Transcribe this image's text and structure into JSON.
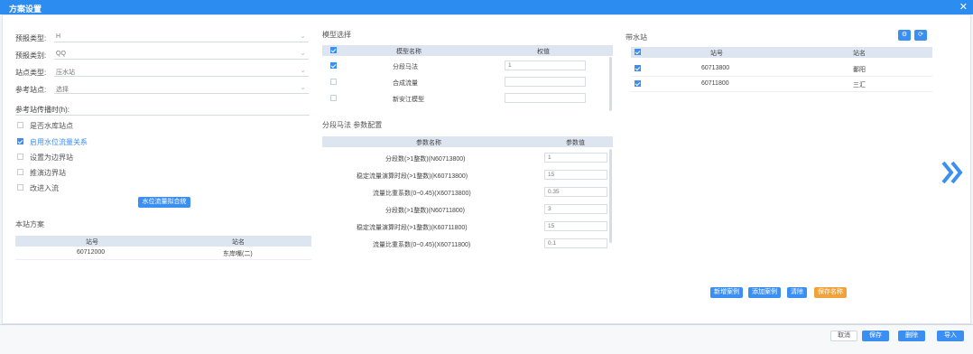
{
  "window": {
    "title": "方案设置",
    "close": "✕"
  },
  "left": {
    "fields": [
      {
        "label": "预报类型:",
        "value": "H"
      },
      {
        "label": "预报类别:",
        "value": "QQ"
      },
      {
        "label": "站点类型:",
        "value": "压水站"
      },
      {
        "label": "参考站点:",
        "value": "选择"
      }
    ],
    "ref_input_label": "参考站传播时(h):",
    "checkboxes": [
      {
        "label": "是否水库站点",
        "checked": false
      },
      {
        "label": "启用水位流量关系",
        "checked": true
      },
      {
        "label": "设置为边界站",
        "checked": false
      },
      {
        "label": "推演边界站",
        "checked": false
      },
      {
        "label": "改进入流",
        "checked": false
      }
    ],
    "relation_button": "水位流量拟合统",
    "station_section": "本站方案",
    "station_table": {
      "headers": [
        "站号",
        "站名"
      ],
      "rows": [
        [
          "60712000",
          "东岸嘴(二)"
        ]
      ]
    }
  },
  "middle": {
    "model_section": "模型选择",
    "model_table": {
      "headers": [
        "模型名称",
        "权值"
      ],
      "rows": [
        {
          "name": "分段马法",
          "checked": true,
          "value": "1"
        },
        {
          "name": "合成流量",
          "checked": false,
          "value": ""
        },
        {
          "name": "新安江模型",
          "checked": false,
          "value": ""
        }
      ]
    },
    "param_section": "分段马法 参数配置",
    "param_table": {
      "headers": [
        "参数名称",
        "参数值"
      ],
      "rows": [
        {
          "name": "分段数(>1整数)(N60713800)",
          "value": "1"
        },
        {
          "name": "稳定流量演算时段(>1整数)(K60713800)",
          "value": "15"
        },
        {
          "name": "流量比重系数(0~0.45)(X60713800)",
          "value": "0.35"
        },
        {
          "name": "分段数(>1整数)(N60711800)",
          "value": "3"
        },
        {
          "name": "稳定流量演算时段(>1整数)(K60711800)",
          "value": "15"
        },
        {
          "name": "流量比重系数(0~0.45)(X60711800)",
          "value": "0.1"
        }
      ]
    }
  },
  "right": {
    "section": "带水站",
    "table": {
      "headers": [
        "站号",
        "站名"
      ],
      "rows": [
        {
          "checked": true,
          "id": "60713800",
          "name": "鄱阳"
        },
        {
          "checked": true,
          "id": "60711800",
          "name": "三汇"
        }
      ]
    },
    "action_buttons": [
      "新增案例",
      "添加案例",
      "清除",
      "保存名称"
    ]
  },
  "footer": {
    "buttons": [
      "取消",
      "保存",
      "删除",
      "导入"
    ]
  },
  "colors": {
    "accent": "#3b8ff3",
    "title_bar": "#2d8cf0",
    "orange": "#f0a23b"
  },
  "icons": {
    "next": "double-chevron-right-icon",
    "close": "close-icon"
  }
}
